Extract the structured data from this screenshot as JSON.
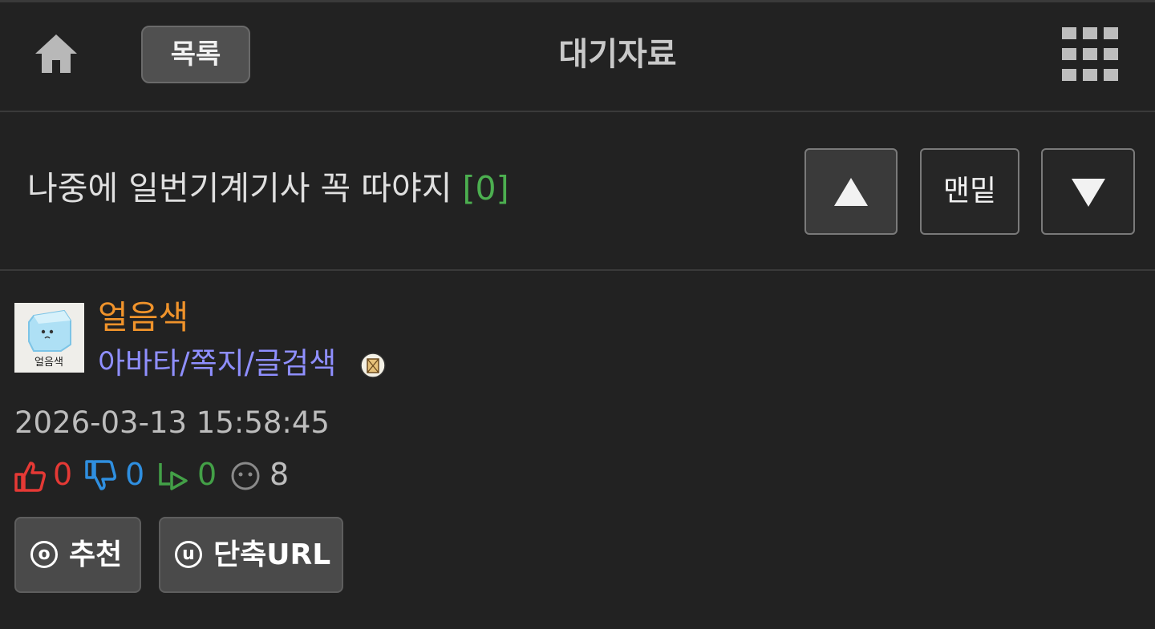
{
  "header": {
    "home_icon": "home-icon",
    "list_button": "목록",
    "board_title": "대기자료",
    "menu_icon": "grid-menu-icon"
  },
  "post": {
    "subject": "나중에 일번기계기사 꼭 따야지",
    "comment_count": "[0]",
    "nav": {
      "up_icon": "triangle-up-icon",
      "bottom_label": "맨밑",
      "down_icon": "triangle-down-icon"
    }
  },
  "author": {
    "name": "얼음색",
    "avatar_caption": "얼음색",
    "links": "아바타/쪽지/글검색",
    "memo_icon": "memo-icon"
  },
  "datetime": "2026-03-13 15:58:45",
  "stats": {
    "likes": "0",
    "dislikes": "0",
    "shares": "0",
    "views": "8",
    "colors": {
      "likes": "#e53935",
      "dislikes": "#2f8fe0",
      "shares": "#43a047",
      "views": "#bdbdbd"
    }
  },
  "actions": {
    "recommend_key": "o",
    "recommend_label": "추천",
    "shorturl_key": "u",
    "shorturl_label": "단축URL"
  }
}
